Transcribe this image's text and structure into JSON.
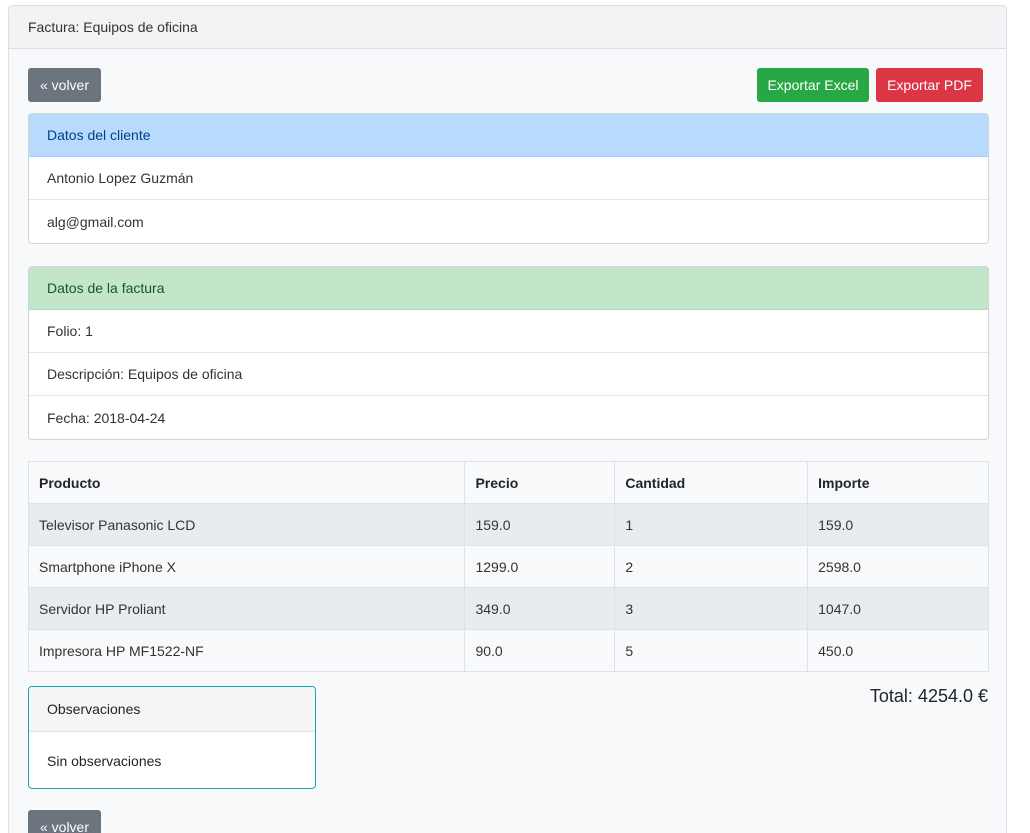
{
  "header": {
    "title": "Factura: Equipos de oficina"
  },
  "actions": {
    "back_label": "« volver",
    "excel_label": "Exportar Excel",
    "pdf_label": "Exportar PDF"
  },
  "client": {
    "title": "Datos del cliente",
    "name": "Antonio Lopez Guzmán",
    "email": "alg@gmail.com"
  },
  "invoice": {
    "title": "Datos de la factura",
    "folio": "Folio: 1",
    "description": "Descripción: Equipos de oficina",
    "date": "Fecha: 2018-04-24"
  },
  "table": {
    "headers": [
      "Producto",
      "Precio",
      "Cantidad",
      "Importe"
    ],
    "rows": [
      [
        "Televisor Panasonic LCD",
        "159.0",
        "1",
        "159.0"
      ],
      [
        "Smartphone iPhone X",
        "1299.0",
        "2",
        "2598.0"
      ],
      [
        "Servidor HP Proliant",
        "349.0",
        "3",
        "1047.0"
      ],
      [
        "Impresora HP MF1522-NF",
        "90.0",
        "5",
        "450.0"
      ]
    ]
  },
  "observations": {
    "title": "Observaciones",
    "text": "Sin observaciones"
  },
  "total": "Total: 4254.0 €",
  "colors": {
    "back": "#6c757d",
    "excel": "#28a745",
    "pdf": "#dc3545",
    "client_header": "#b8daff",
    "invoice_header": "#c3e6cb",
    "observations_border": "#17a2b8"
  }
}
